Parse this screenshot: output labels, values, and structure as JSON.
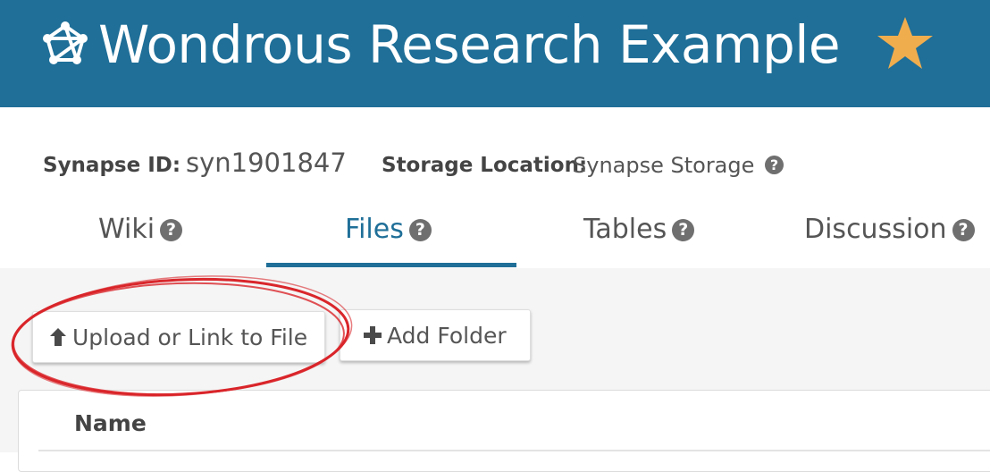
{
  "header": {
    "project_title": "Wondrous Research Example",
    "project_icon": "synapse-project-icon",
    "favorite_icon": "star-icon",
    "background_color": "#1f6f98",
    "star_color": "#f0ad4e"
  },
  "meta": {
    "synapse_id_label": "Synapse ID:",
    "synapse_id_value": "syn1901847",
    "storage_label": "Storage Location:",
    "storage_value": "Synapse Storage",
    "help_icon": "question-circle-icon"
  },
  "tabs": [
    {
      "label": "Wiki",
      "active": false
    },
    {
      "label": "Files",
      "active": true
    },
    {
      "label": "Tables",
      "active": false
    },
    {
      "label": "Discussion",
      "active": false
    }
  ],
  "toolbar": {
    "upload_label": "Upload or Link to File",
    "upload_icon": "arrow-up-icon",
    "add_folder_label": "Add Folder",
    "add_folder_icon": "plus-icon"
  },
  "table": {
    "columns": [
      "Name"
    ]
  },
  "annotation": {
    "shape": "hand-drawn-ellipse",
    "color": "#d9262b"
  }
}
